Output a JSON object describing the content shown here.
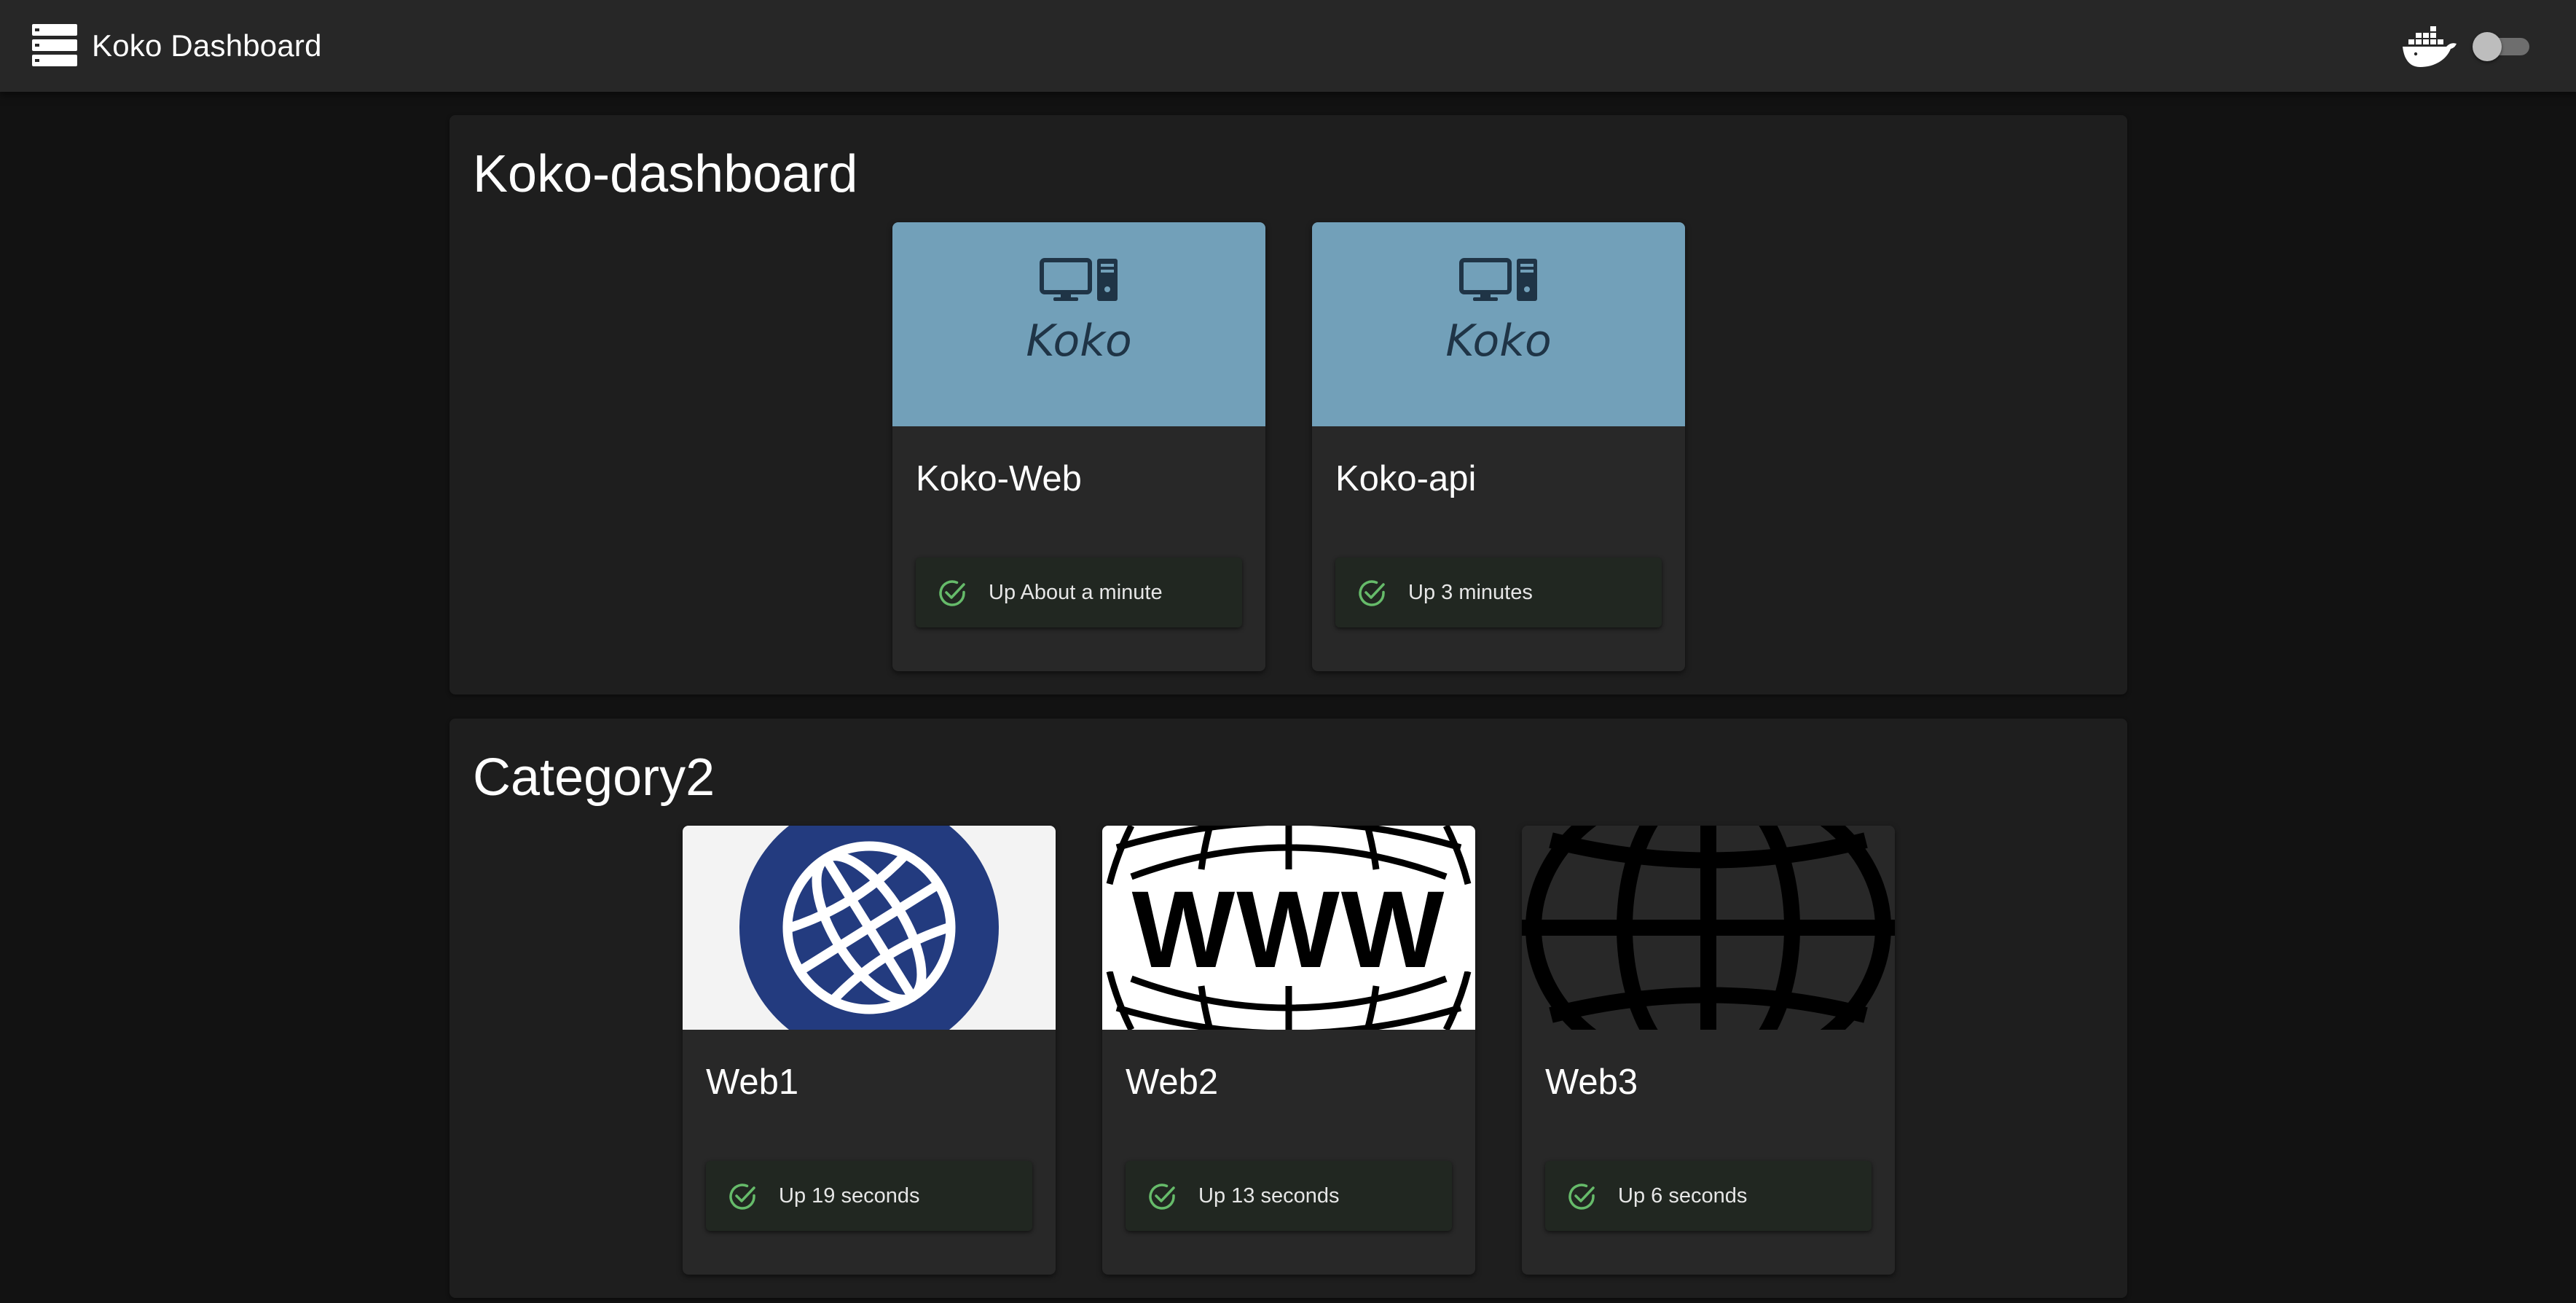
{
  "header": {
    "title": "Koko Dashboard",
    "menu_icon": "menu-list-icon",
    "docker_icon": "docker-whale-icon",
    "theme_toggle": {
      "checked": false
    }
  },
  "categories": [
    {
      "title": "Koko-dashboard",
      "cards": [
        {
          "title": "Koko-Web",
          "image_icon": "koko-logo",
          "image_text": "Koko",
          "status": "Up About a minute",
          "status_icon": "check-circle-icon"
        },
        {
          "title": "Koko-api",
          "image_icon": "koko-logo",
          "image_text": "Koko",
          "status": "Up 3 minutes",
          "status_icon": "check-circle-icon"
        }
      ]
    },
    {
      "title": "Category2",
      "cards": [
        {
          "title": "Web1",
          "image_icon": "globe-icon",
          "status": "Up 19 seconds",
          "status_icon": "check-circle-icon"
        },
        {
          "title": "Web2",
          "image_icon": "www-globe-icon",
          "image_text": "WWW",
          "status": "Up 13 seconds",
          "status_icon": "check-circle-icon"
        },
        {
          "title": "Web3",
          "image_icon": "globe-outline-icon",
          "status": "Up 6 seconds",
          "status_icon": "check-circle-icon"
        }
      ]
    }
  ],
  "colors": {
    "background": "#121212",
    "appbar": "#272727",
    "panel": "#1e1e1e",
    "card": "#282828",
    "status_green": "#66bb6a",
    "koko_banner": "#72a0b9",
    "web1_globe": "#233b7f"
  }
}
